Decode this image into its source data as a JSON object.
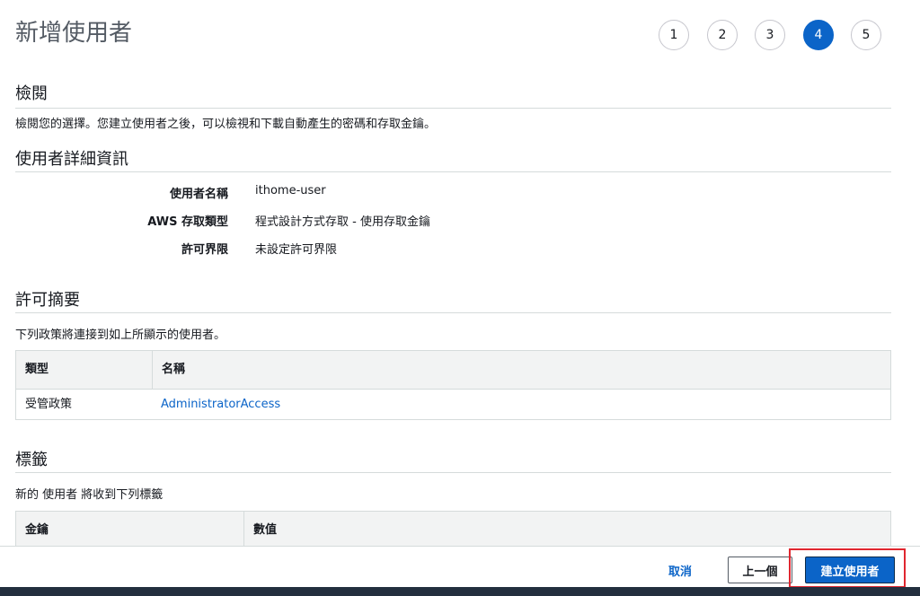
{
  "page": {
    "title": "新增使用者"
  },
  "wizard": {
    "steps": [
      "1",
      "2",
      "3",
      "4",
      "5"
    ],
    "active_step": 4
  },
  "review": {
    "heading": "檢閱",
    "description": "檢閱您的選擇。您建立使用者之後，可以檢視和下載自動產生的密碼和存取金鑰。"
  },
  "user_details": {
    "heading": "使用者詳細資訊",
    "rows": [
      {
        "label": "使用者名稱",
        "value": "ithome-user"
      },
      {
        "label": "AWS 存取類型",
        "value": "程式設計方式存取 - 使用存取金鑰"
      },
      {
        "label": "許可界限",
        "value": "未設定許可界限"
      }
    ]
  },
  "permissions": {
    "heading": "許可摘要",
    "description": "下列政策將連接到如上所顯示的使用者。",
    "columns": [
      "類型",
      "名稱"
    ],
    "rows": [
      {
        "type": "受管政策",
        "name": "AdministratorAccess"
      }
    ]
  },
  "tags": {
    "heading": "標籤",
    "description": "新的 使用者 將收到下列標籤",
    "columns": [
      "金鑰",
      "數值"
    ]
  },
  "footer": {
    "cancel": "取消",
    "previous": "上一個",
    "create": "建立使用者"
  },
  "colors": {
    "accent": "#0b64c8",
    "highlight": "#e0262f",
    "footer_bar": "#232f3e"
  }
}
